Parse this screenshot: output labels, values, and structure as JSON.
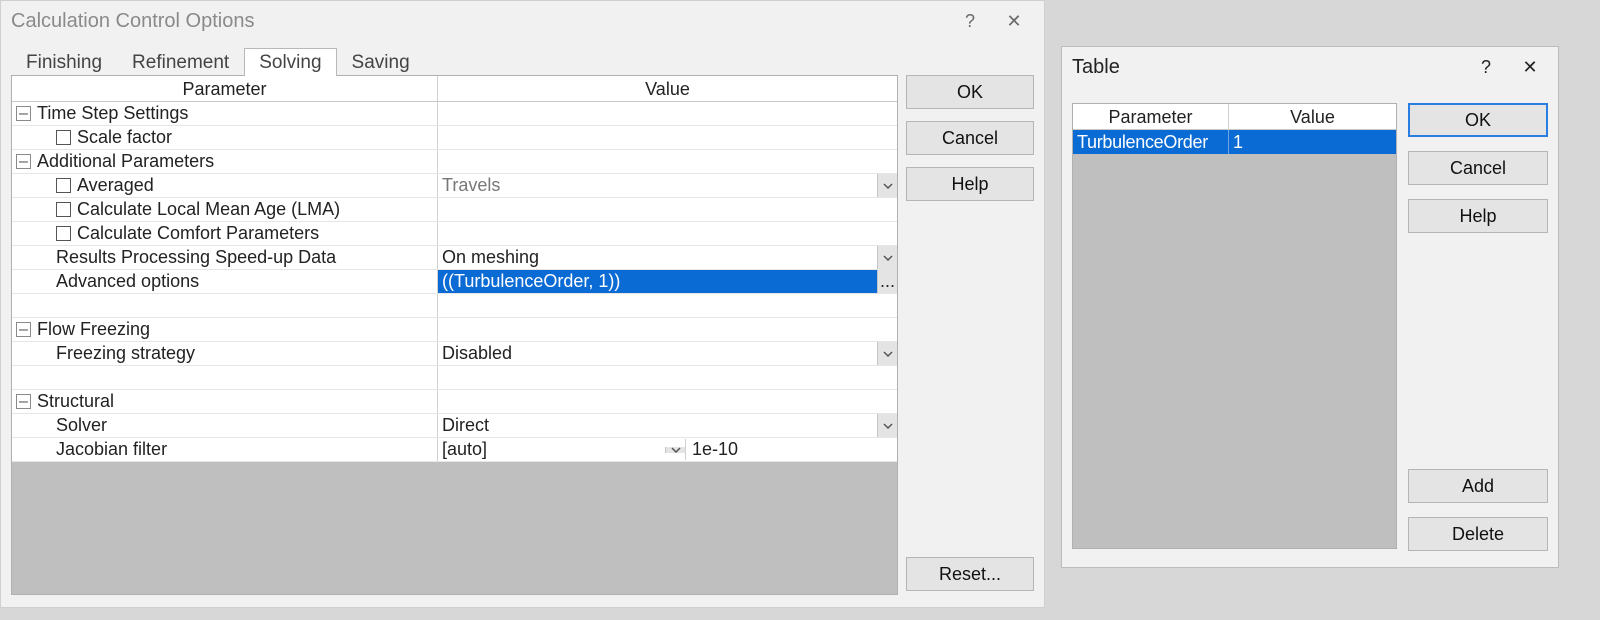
{
  "colors": {
    "selection": "#0a6bd4"
  },
  "mainDialog": {
    "title": "Calculation Control Options",
    "tabs": {
      "finishing": "Finishing",
      "refinement": "Refinement",
      "solving": "Solving",
      "saving": "Saving",
      "active": "Solving"
    },
    "columns": {
      "parameter": "Parameter",
      "value": "Value"
    },
    "buttons": {
      "ok": "OK",
      "cancel": "Cancel",
      "help": "Help",
      "reset": "Reset..."
    },
    "icons": {
      "help": "?",
      "close": "✕",
      "min": "–",
      "chevron": "⌄",
      "ellipsis": "..."
    }
  },
  "groups": {
    "timeStep": {
      "label": "Time Step Settings",
      "items": {
        "scaleFactor": "Scale factor"
      }
    },
    "additional": {
      "label": "Additional Parameters",
      "items": {
        "averaged": "Averaged",
        "averaged_value": "Travels",
        "lma": "Calculate Local Mean Age (LMA)",
        "comfort": "Calculate Comfort Parameters",
        "speedup": "Results Processing Speed-up Data",
        "speedup_value": "On meshing",
        "advanced": "Advanced options",
        "advanced_value": "((TurbulenceOrder, 1))"
      }
    },
    "flowFreezing": {
      "label": "Flow Freezing",
      "items": {
        "strategy": "Freezing strategy",
        "strategy_value": "Disabled"
      }
    },
    "structural": {
      "label": "Structural",
      "items": {
        "solver": "Solver",
        "solver_value": "Direct",
        "jacobian": "Jacobian filter",
        "jacobian_value": "[auto]",
        "jacobian_num": "1e-10"
      }
    }
  },
  "tableDialog": {
    "title": "Table",
    "columns": {
      "parameter": "Parameter",
      "value": "Value"
    },
    "rows": [
      {
        "parameter": "TurbulenceOrder",
        "value": "1"
      }
    ],
    "buttons": {
      "ok": "OK",
      "cancel": "Cancel",
      "help": "Help",
      "add": "Add",
      "delete": "Delete"
    },
    "icons": {
      "help": "?",
      "close": "✕"
    }
  }
}
